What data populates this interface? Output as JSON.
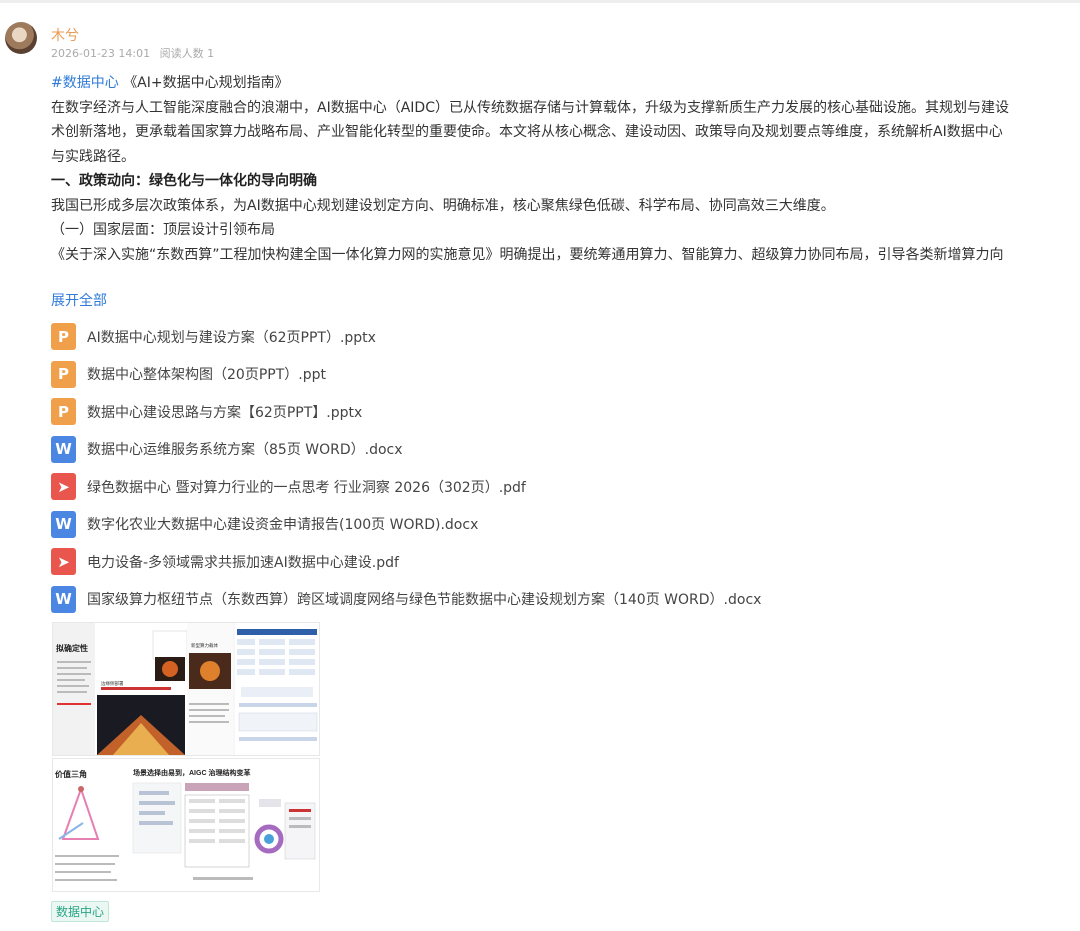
{
  "post": {
    "username": "木兮",
    "datetime": "2026-01-23 14:01",
    "read_count": "阅读人数 1",
    "hashtag": "#数据中心",
    "title": "《AI+数据中心规划指南》",
    "paragraphs": [
      "在数字经济与人工智能深度融合的浪潮中，AI数据中心（AIDC）已从传统数据存储与计算载体，升级为支撑新质生产力发展的核心基础设施。其规划与建设",
      "术创新落地，更承载着国家算力战略布局、产业智能化转型的重要使命。本文将从核心概念、建设动因、政策导向及规划要点等维度，系统解析AI数据中心",
      "与实践路径。"
    ],
    "section_heading": "一、政策动向：绿色化与一体化的导向明确",
    "section_text": "我国已形成多层次政策体系，为AI数据中心规划建设划定方向、明确标准，核心聚焦绿色低碳、科学布局、协同高效三大维度。",
    "subsection_heading": "（一）国家层面：顶层设计引领布局",
    "subsection_text": "《关于深入实施“东数西算”工程加快构建全国一体化算力网的实施意见》明确提出，要统筹通用算力、智能算力、超级算力协同布局，引导各类新增算力向",
    "expand_label": "展开全部",
    "tag": "数据中心"
  },
  "attachments": [
    {
      "type": "ppt",
      "icon": "ppt-file-icon",
      "glyph": "P",
      "name": "AI数据中心规划与建设方案（62页PPT）.pptx"
    },
    {
      "type": "ppt",
      "icon": "ppt-file-icon",
      "glyph": "P",
      "name": "数据中心整体架构图（20页PPT）.ppt"
    },
    {
      "type": "ppt",
      "icon": "ppt-file-icon",
      "glyph": "P",
      "name": "数据中心建设思路与方案【62页PPT】.pptx"
    },
    {
      "type": "doc",
      "icon": "word-file-icon",
      "glyph": "W",
      "name": "数据中心运维服务系统方案（85页 WORD）.docx"
    },
    {
      "type": "pdf",
      "icon": "pdf-file-icon",
      "glyph": "➤",
      "name": "绿色数据中心 暨对算力行业的一点思考 行业洞察 2026（302页）.pdf"
    },
    {
      "type": "doc",
      "icon": "word-file-icon",
      "glyph": "W",
      "name": "数字化农业大数据中心建设资金申请报告(100页 WORD).docx"
    },
    {
      "type": "pdf",
      "icon": "pdf-file-icon",
      "glyph": "➤",
      "name": "电力设备-多领域需求共振加速AI数据中心建设.pdf"
    },
    {
      "type": "doc",
      "icon": "word-file-icon",
      "glyph": "W",
      "name": "国家级算力枢纽节点（东数西算）跨区域调度网络与绿色节能数据中心建设规划方案（140页 WORD）.docx"
    }
  ],
  "images": {
    "thumb1": {
      "heading": "拟确定性",
      "caption1": "边缘侧部署",
      "caption2": "新型算力载体"
    },
    "thumb2": {
      "heading": "价值三角",
      "title": "场景选择由易到，AIGC 治理结构变革"
    }
  }
}
